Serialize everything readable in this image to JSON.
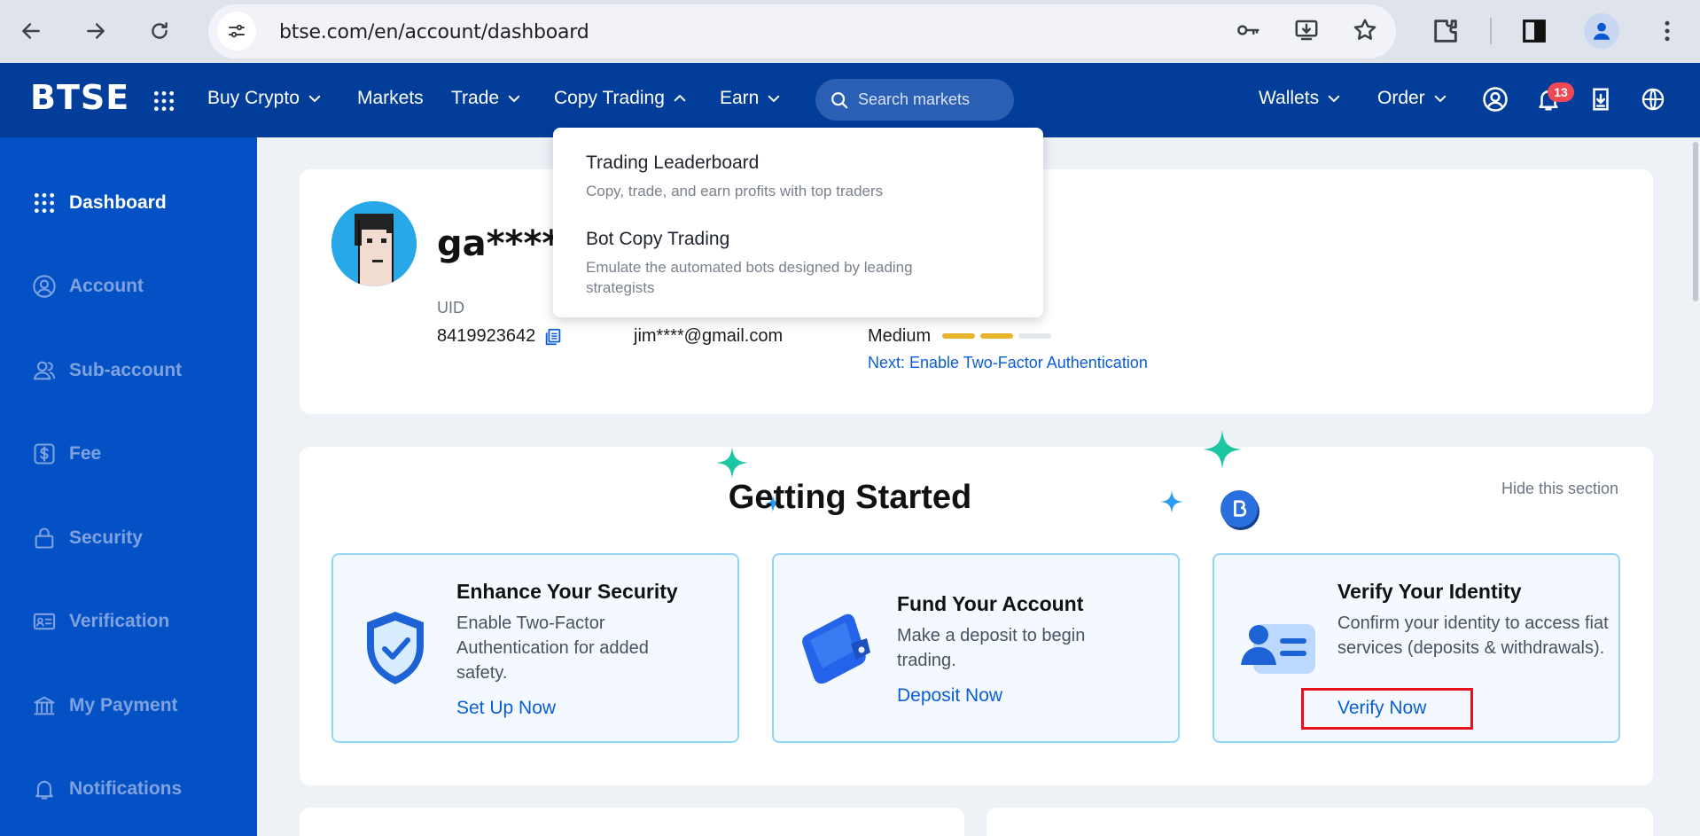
{
  "browser": {
    "url": "btse.com/en/account/dashboard"
  },
  "header": {
    "logo": "BTSE",
    "nav": {
      "buy_crypto": "Buy Crypto",
      "markets": "Markets",
      "trade": "Trade",
      "copy_trading": "Copy Trading",
      "earn": "Earn"
    },
    "search_placeholder": "Search markets",
    "wallets": "Wallets",
    "order": "Order",
    "notification_count": "13"
  },
  "copy_trading_menu": {
    "items": [
      {
        "title": "Trading Leaderboard",
        "description": "Copy, trade, and earn profits with top traders"
      },
      {
        "title": "Bot Copy Trading",
        "description": "Emulate the automated bots designed by leading strategists"
      }
    ]
  },
  "sidebar": {
    "items": [
      {
        "label": "Dashboard",
        "icon": "grid-icon",
        "active": true
      },
      {
        "label": "Account",
        "icon": "user-circle-icon"
      },
      {
        "label": "Sub-account",
        "icon": "users-icon"
      },
      {
        "label": "Fee",
        "icon": "dollar-icon"
      },
      {
        "label": "Security",
        "icon": "lock-icon"
      },
      {
        "label": "Verification",
        "icon": "id-card-icon"
      },
      {
        "label": "My Payment",
        "icon": "bank-icon"
      },
      {
        "label": "Notifications",
        "icon": "bell-icon"
      }
    ]
  },
  "profile": {
    "username": "ga****c",
    "uid_label": "UID",
    "uid_value": "8419923642",
    "email": "jim****@gmail.com",
    "security_level": "Medium",
    "security_bars_filled": 2,
    "security_bars_total": 3,
    "next_step": "Next: Enable Two-Factor Authentication"
  },
  "getting_started": {
    "title": "Getting Started",
    "hide_label": "Hide this section",
    "cards": [
      {
        "title": "Enhance Your Security",
        "description": "Enable Two-Factor Authentication for added safety.",
        "action": "Set Up Now",
        "icon": "shield-check-icon"
      },
      {
        "title": "Fund Your Account",
        "description": "Make a deposit to begin trading.",
        "action": "Deposit Now",
        "icon": "wallet-icon"
      },
      {
        "title": "Verify Your Identity",
        "description": "Confirm your identity to access fiat services (deposits & withdrawals).",
        "action": "Verify Now",
        "icon": "id-card-icon"
      }
    ]
  },
  "colors": {
    "header_bg": "#023d9a",
    "sidebar_bg": "#0451c6",
    "link": "#0b5ed7",
    "security_bar_filled": "#e7b52c",
    "security_bar_empty": "#e4e7ec",
    "highlight": "#e4121d"
  }
}
